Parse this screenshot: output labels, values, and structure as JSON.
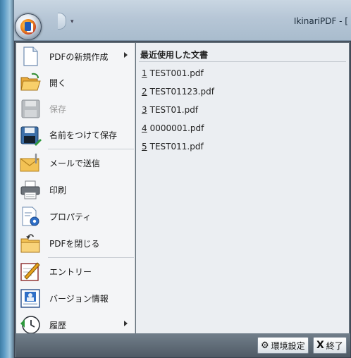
{
  "window": {
    "title": "IkinariPDF - [",
    "qat_dropdown_glyph": "▾"
  },
  "menu": {
    "items": [
      {
        "label": "PDFの新規作成",
        "icon": "new-document-icon",
        "has_submenu": true,
        "enabled": true
      },
      {
        "label": "開く",
        "icon": "open-folder-icon",
        "has_submenu": false,
        "enabled": true
      },
      {
        "label": "保存",
        "icon": "save-disk-icon",
        "has_submenu": false,
        "enabled": false
      },
      {
        "label": "名前をつけて保存",
        "icon": "save-as-icon",
        "has_submenu": false,
        "enabled": true
      },
      {
        "label": "メールで送信",
        "icon": "mail-envelope-icon",
        "has_submenu": false,
        "enabled": true
      },
      {
        "label": "印刷",
        "icon": "printer-icon",
        "has_submenu": false,
        "enabled": true
      },
      {
        "label": "プロパティ",
        "icon": "properties-icon",
        "has_submenu": false,
        "enabled": true
      },
      {
        "label": "PDFを閉じる",
        "icon": "close-folder-icon",
        "has_submenu": false,
        "enabled": true
      },
      {
        "label": "エントリー",
        "icon": "entry-pen-icon",
        "has_submenu": false,
        "enabled": true
      },
      {
        "label": "バージョン情報",
        "icon": "version-info-icon",
        "has_submenu": false,
        "enabled": true
      },
      {
        "label": "履歴",
        "icon": "history-clock-icon",
        "has_submenu": true,
        "enabled": true
      }
    ]
  },
  "recent": {
    "title": "最近使用した文書",
    "items": [
      {
        "num": "1",
        "name": "TEST001.pdf"
      },
      {
        "num": "2",
        "name": "TEST01123.pdf"
      },
      {
        "num": "3",
        "name": "TEST01.pdf"
      },
      {
        "num": "4",
        "name": "0000001.pdf"
      },
      {
        "num": "5",
        "name": "TEST011.pdf"
      }
    ]
  },
  "footer": {
    "settings_label": "環境設定",
    "settings_icon_glyph": "⚙",
    "exit_label": "終了",
    "exit_icon_glyph": "X"
  },
  "colors": {
    "accent": "#2b5fb0",
    "pane_left": "#f4f5f7",
    "pane_right": "#ebeef2",
    "disabled_text": "#9a9a9a"
  }
}
